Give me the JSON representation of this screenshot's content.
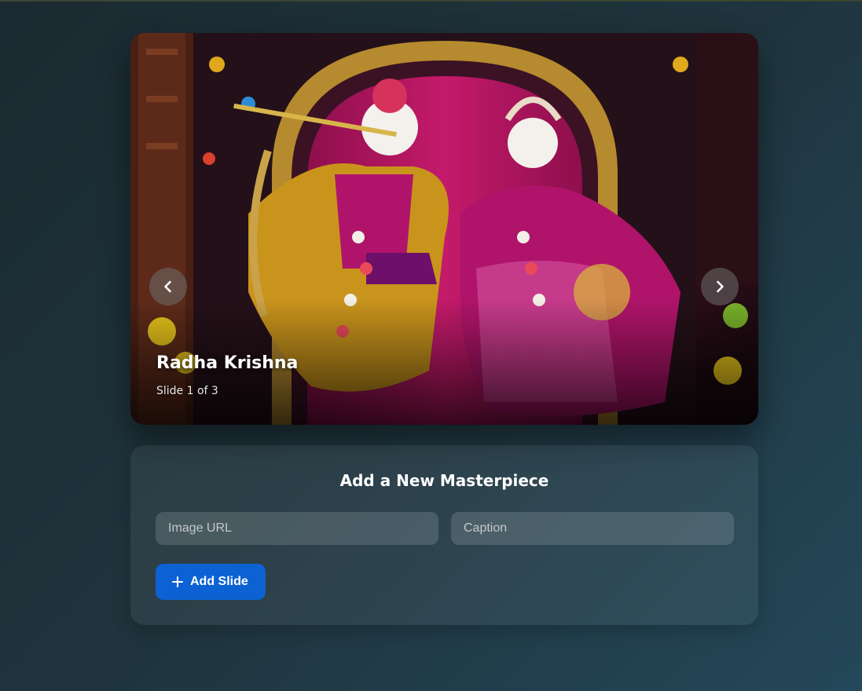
{
  "carousel": {
    "slide": {
      "title": "Radha Krishna",
      "counter": "Slide 1 of 3"
    },
    "prev_icon": "chevron-left-icon",
    "next_icon": "chevron-right-icon"
  },
  "form": {
    "title": "Add a New Masterpiece",
    "image_url_placeholder": "Image URL",
    "caption_placeholder": "Caption",
    "add_button_icon": "plus-icon",
    "add_button_label": "Add Slide"
  },
  "colors": {
    "accent": "#0d62d3",
    "background": "#1f343d"
  }
}
